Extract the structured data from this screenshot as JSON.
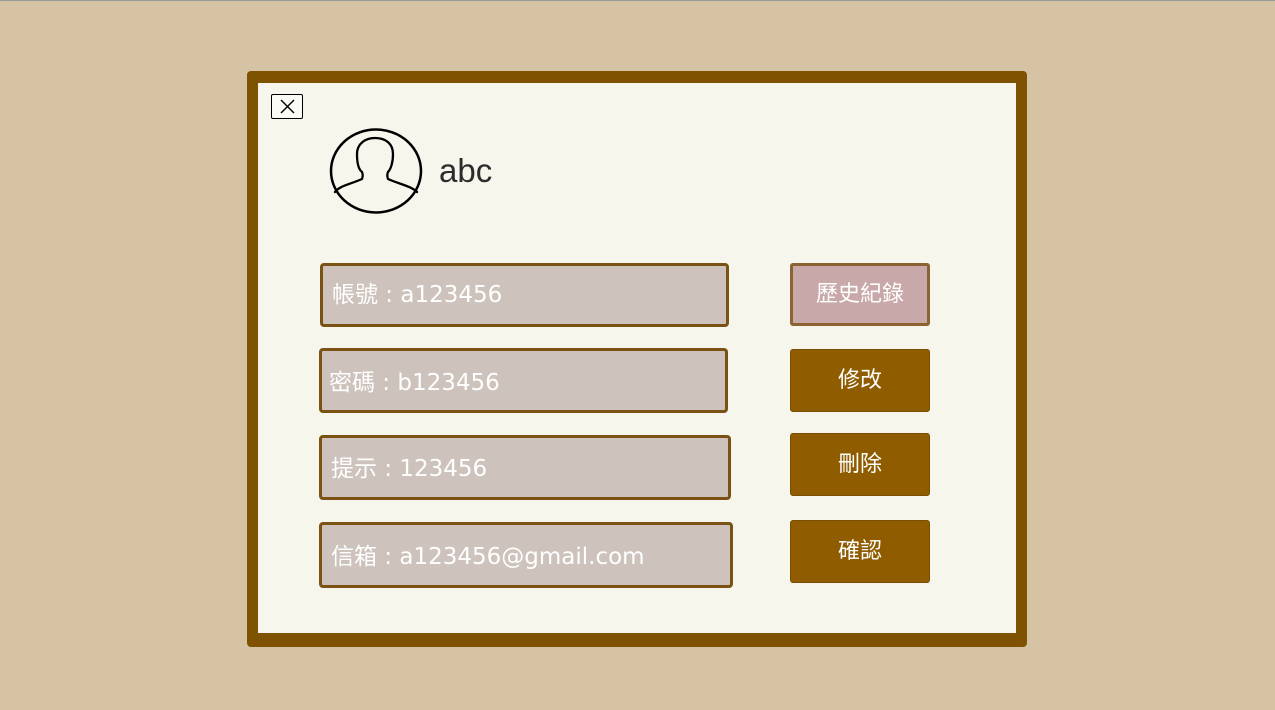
{
  "profile": {
    "username": "abc"
  },
  "fields": {
    "account": "帳號 : a123456",
    "password": "密碼 :  b123456",
    "hint": "提示 : 123456",
    "email": "信箱 : a123456@gmail.com"
  },
  "buttons": {
    "history": "歷史紀錄",
    "edit": "修改",
    "delete": "刪除",
    "confirm": "確認"
  },
  "colors": {
    "background": "#d6c3a3",
    "dialog_frame": "#7f5200",
    "dialog_panel": "#f7f6ec",
    "field_fill": "#cdc2bc",
    "history_button": "#c8a8a8",
    "action_button": "#8f5c00"
  },
  "icons": {
    "close": "close-icon",
    "avatar": "user-avatar-icon"
  }
}
